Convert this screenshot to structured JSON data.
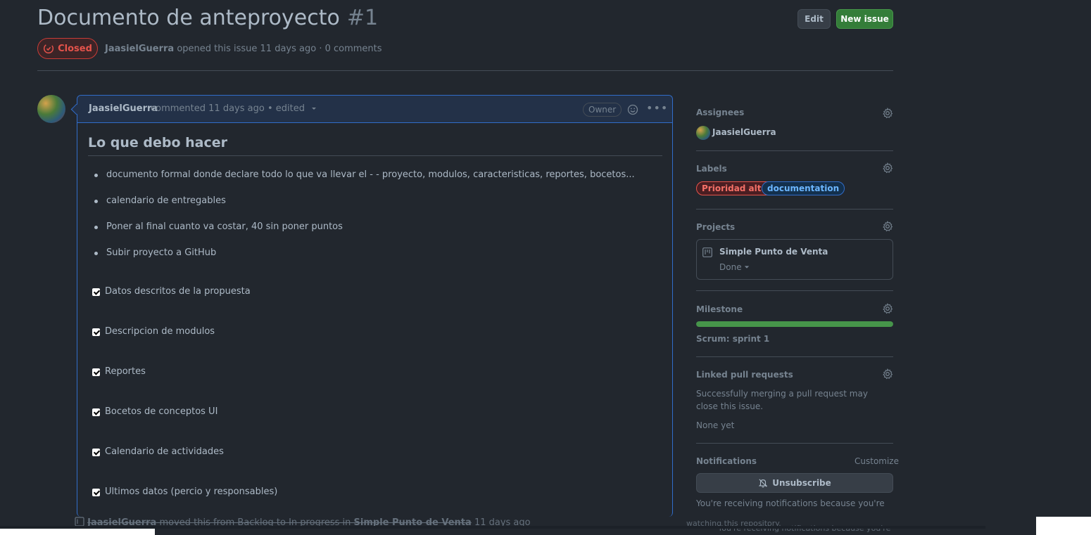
{
  "issue": {
    "title": "Documento de anteproyecto",
    "number": "#1",
    "state": "Closed",
    "author": "JaasielGuerra",
    "opened_text": "opened this issue 11 days ago · 0 comments"
  },
  "header_buttons": {
    "edit_label": "Edit",
    "new_issue_label": "New issue"
  },
  "comment": {
    "author": "JaasielGuerra",
    "meta": "commented 11 days ago • edited",
    "owner_badge": "Owner",
    "heading": "Lo que debo hacer",
    "bullets": [
      "documento formal donde declare todo lo que va llevar el - - proyecto, modulos, caracteristicas, reportes, bocetos...",
      "calendario de entregables",
      "Poner al final cuanto va costar, 40 sin poner puntos",
      "Subir proyecto a GitHub"
    ],
    "tasks": [
      "Datos descritos de la propuesta",
      "Descripcion de modulos",
      "Reportes",
      "Bocetos de conceptos UI",
      "Calendario de actividades",
      "Ultimos datos (percio y responsables)"
    ]
  },
  "timeline": {
    "actor": "JaasielGuerra",
    "text": "moved this from Backlog to In progress in",
    "project": "Simple Punto de Venta",
    "time": "11 days ago"
  },
  "sidebar": {
    "assignees_heading": "Assignees",
    "assignee": "JaasielGuerra",
    "labels_heading": "Labels",
    "labels": [
      {
        "name": "Prioridad alta",
        "color": "#e5534b"
      },
      {
        "name": "documentation",
        "color": "#316dca"
      }
    ],
    "projects_heading": "Projects",
    "project_name": "Simple Punto de Venta",
    "project_status": "Done",
    "milestone_heading": "Milestone",
    "milestone_progress": 1.0,
    "milestone_name": "Scrum: sprint 1",
    "linked_pr_heading": "Linked pull requests",
    "linked_pr_text": "Successfully merging a pull request may close this issue.",
    "linked_pr_none": "None yet",
    "notifications_heading": "Notifications",
    "customize_label": "Customize",
    "unsubscribe_label": "Unsubscribe",
    "notifications_text": "You're receiving notifications because you're",
    "ghost_text_1": "watching this repository.",
    "ghost_text_2": "You're receiving notifications because you're"
  },
  "colors": {
    "background": "#22272e",
    "accent_blue": "#316dca",
    "closed_red": "#e5534b",
    "success_green": "#46954a"
  }
}
